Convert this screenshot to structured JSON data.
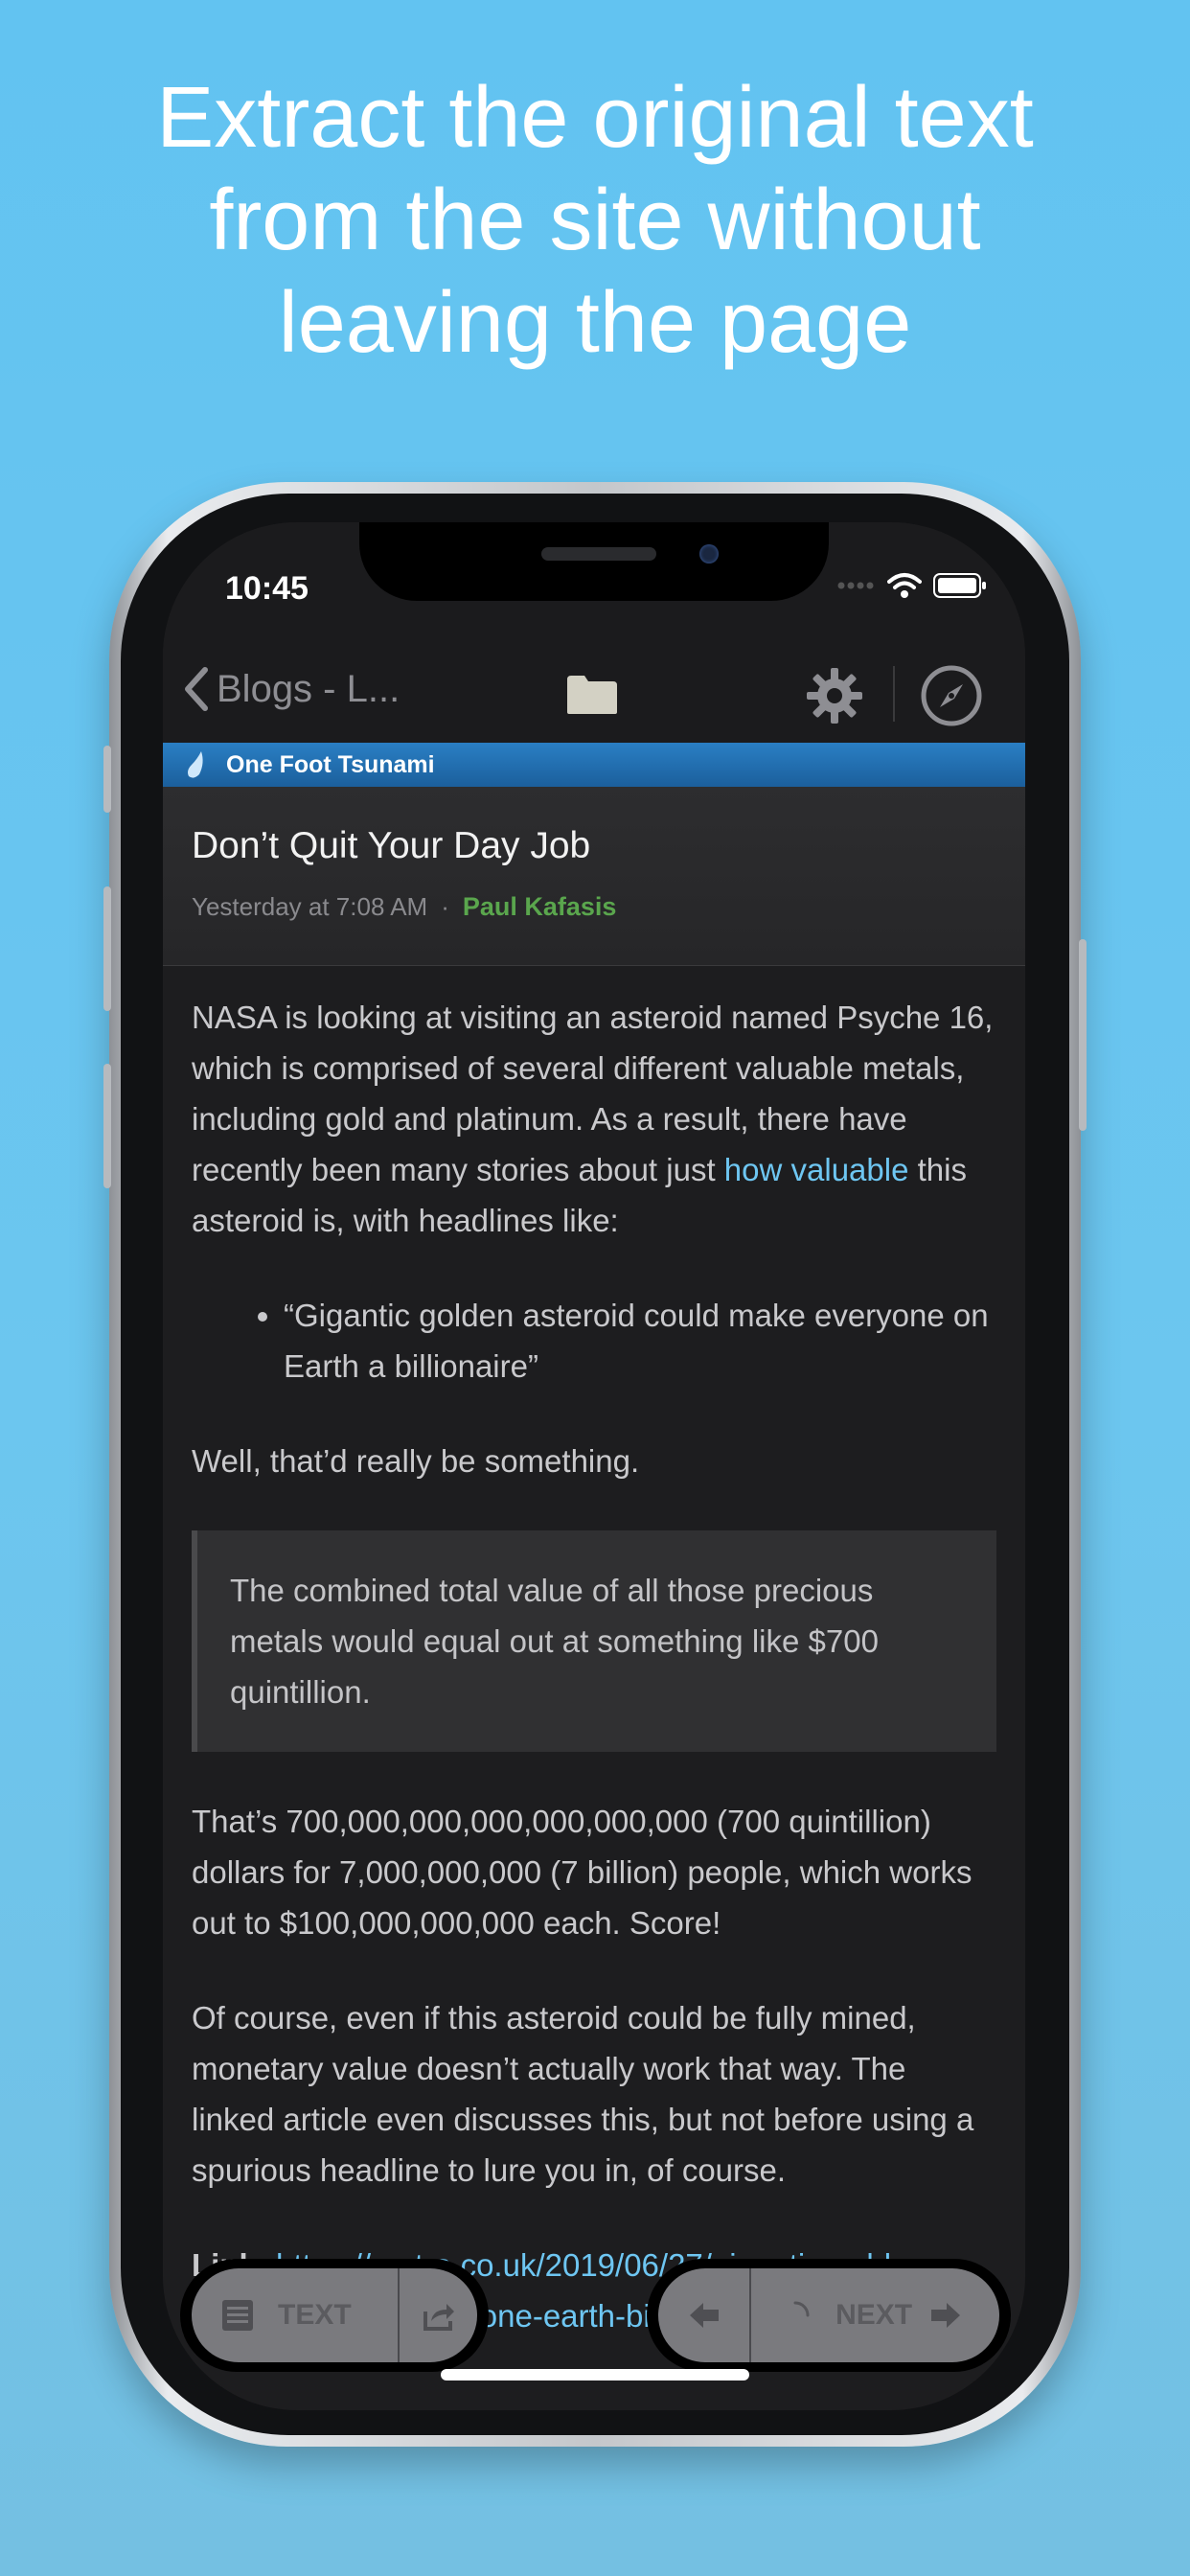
{
  "promo": {
    "line1": "Extract the original text",
    "line2": "from the site without",
    "line3": "leaving the page"
  },
  "status": {
    "time": "10:45"
  },
  "nav": {
    "back_label": "Blogs - L..."
  },
  "feed": {
    "title": "One Foot Tsunami"
  },
  "article": {
    "title": "Don’t Quit Your Day Job",
    "date": "Yesterday at 7:08 AM",
    "separator": "·",
    "author": "Paul Kafasis",
    "p1_before": "NASA is looking at visiting an asteroid named Psyche 16, which is comprised of several different valuable metals, including gold and platinum. As a result, there have recently been many stories about just ",
    "p1_link": "how valuable",
    "p1_after": " this asteroid is, with headlines like:",
    "bullet": "“Gigantic golden asteroid could make everyone on Earth a billionaire”",
    "p2": "Well, that’d really be something.",
    "quote": "The combined total value of all those precious metals would equal out at something like $700 quintillion.",
    "p3": "That’s 700,000,000,000,000,000,000 (700 quintillion) dollars for 7,000,000,000 (7 billion) people, which works out to $100,000,000,000 each. Score!",
    "p4": "Of course, even if this asteroid could be fully mined, monetary value doesn’t actually work that way. The linked article even discusses this, but not before using a spurious headline to lure you in, of course.",
    "link_label": "Link:",
    "link_url": " https://metro.co.uk/2019/06/27/gigantic-golden-asteroid-make-everyone-earth-billionaire-"
  },
  "toolbar": {
    "text_label": "TEXT",
    "next_label": "NEXT"
  },
  "colors": {
    "background": "#62c3f1",
    "link": "#6ec6f2",
    "author": "#5aa64d",
    "feedbar": "#1b5f9c"
  },
  "icons": [
    "chevron-left-icon",
    "folder-icon",
    "gear-icon",
    "compass-icon",
    "droplet-icon",
    "reader-icon",
    "share-icon",
    "arrow-left-icon",
    "spinner-icon",
    "arrow-right-icon",
    "wifi-icon",
    "battery-icon"
  ]
}
